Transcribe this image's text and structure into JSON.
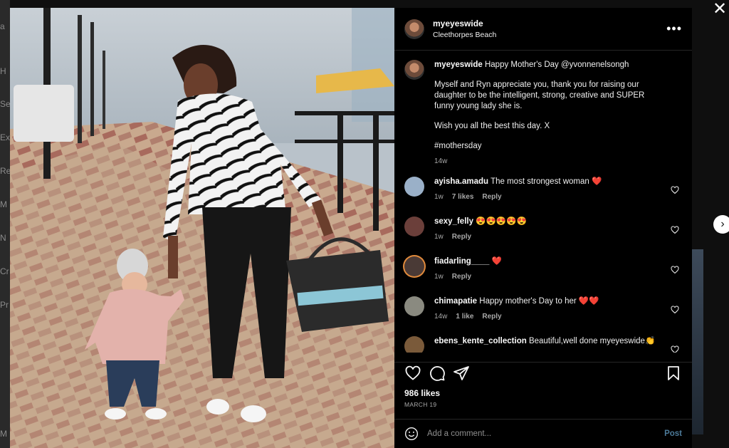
{
  "background": {
    "letters": [
      "a",
      "H",
      "Se",
      "Ex",
      "Re",
      "M",
      "N",
      "Cr",
      "Pr",
      "M"
    ]
  },
  "controls": {
    "close_glyph": "✕",
    "next_glyph": "›"
  },
  "post": {
    "username": "myeyeswide",
    "location": "Cleethorpes Beach",
    "more_glyph": "•••",
    "caption": {
      "username": "myeyeswide",
      "text": "Happy Mother's Day @yvonnenelsongh",
      "para1": "Myself and Ryn appreciate you, thank you for raising our daughter to be the intelligent, strong, creative and SUPER funny young lady she is.",
      "para2": "Wish you all the best this day. X",
      "para3": "#mothersday",
      "time": "14w"
    },
    "comments": [
      {
        "username": "ayisha.amadu",
        "text": "The most strongest woman ❤️",
        "time": "1w",
        "likes": "7 likes",
        "reply": "Reply",
        "avatar_color": "#9ab0c8"
      },
      {
        "username": "sexy_felly",
        "text": "😍😍😍😍😍",
        "time": "1w",
        "likes": "",
        "reply": "Reply",
        "avatar_color": "#6b3f3a"
      },
      {
        "username": "fiadarling____",
        "text": "❤️",
        "time": "1w",
        "likes": "",
        "reply": "Reply",
        "avatar_color": "#4a3a36"
      },
      {
        "username": "chimapatie",
        "text": "Happy mother's Day to her ❤️❤️",
        "time": "14w",
        "likes": "1 like",
        "reply": "Reply",
        "avatar_color": "#8a8a80"
      },
      {
        "username": "ebens_kente_collection",
        "text": "Beautiful,well done myeyeswide👏",
        "time": "",
        "likes": "",
        "reply": "",
        "avatar_color": "#7a5a3a"
      }
    ],
    "likes": "986 likes",
    "date": "MARCH 19",
    "add_comment_placeholder": "Add a comment...",
    "post_label": "Post"
  },
  "colors": {
    "panel_bg": "#000000",
    "post_btn": "#4c7a99",
    "heart_red": "#ed4956"
  }
}
